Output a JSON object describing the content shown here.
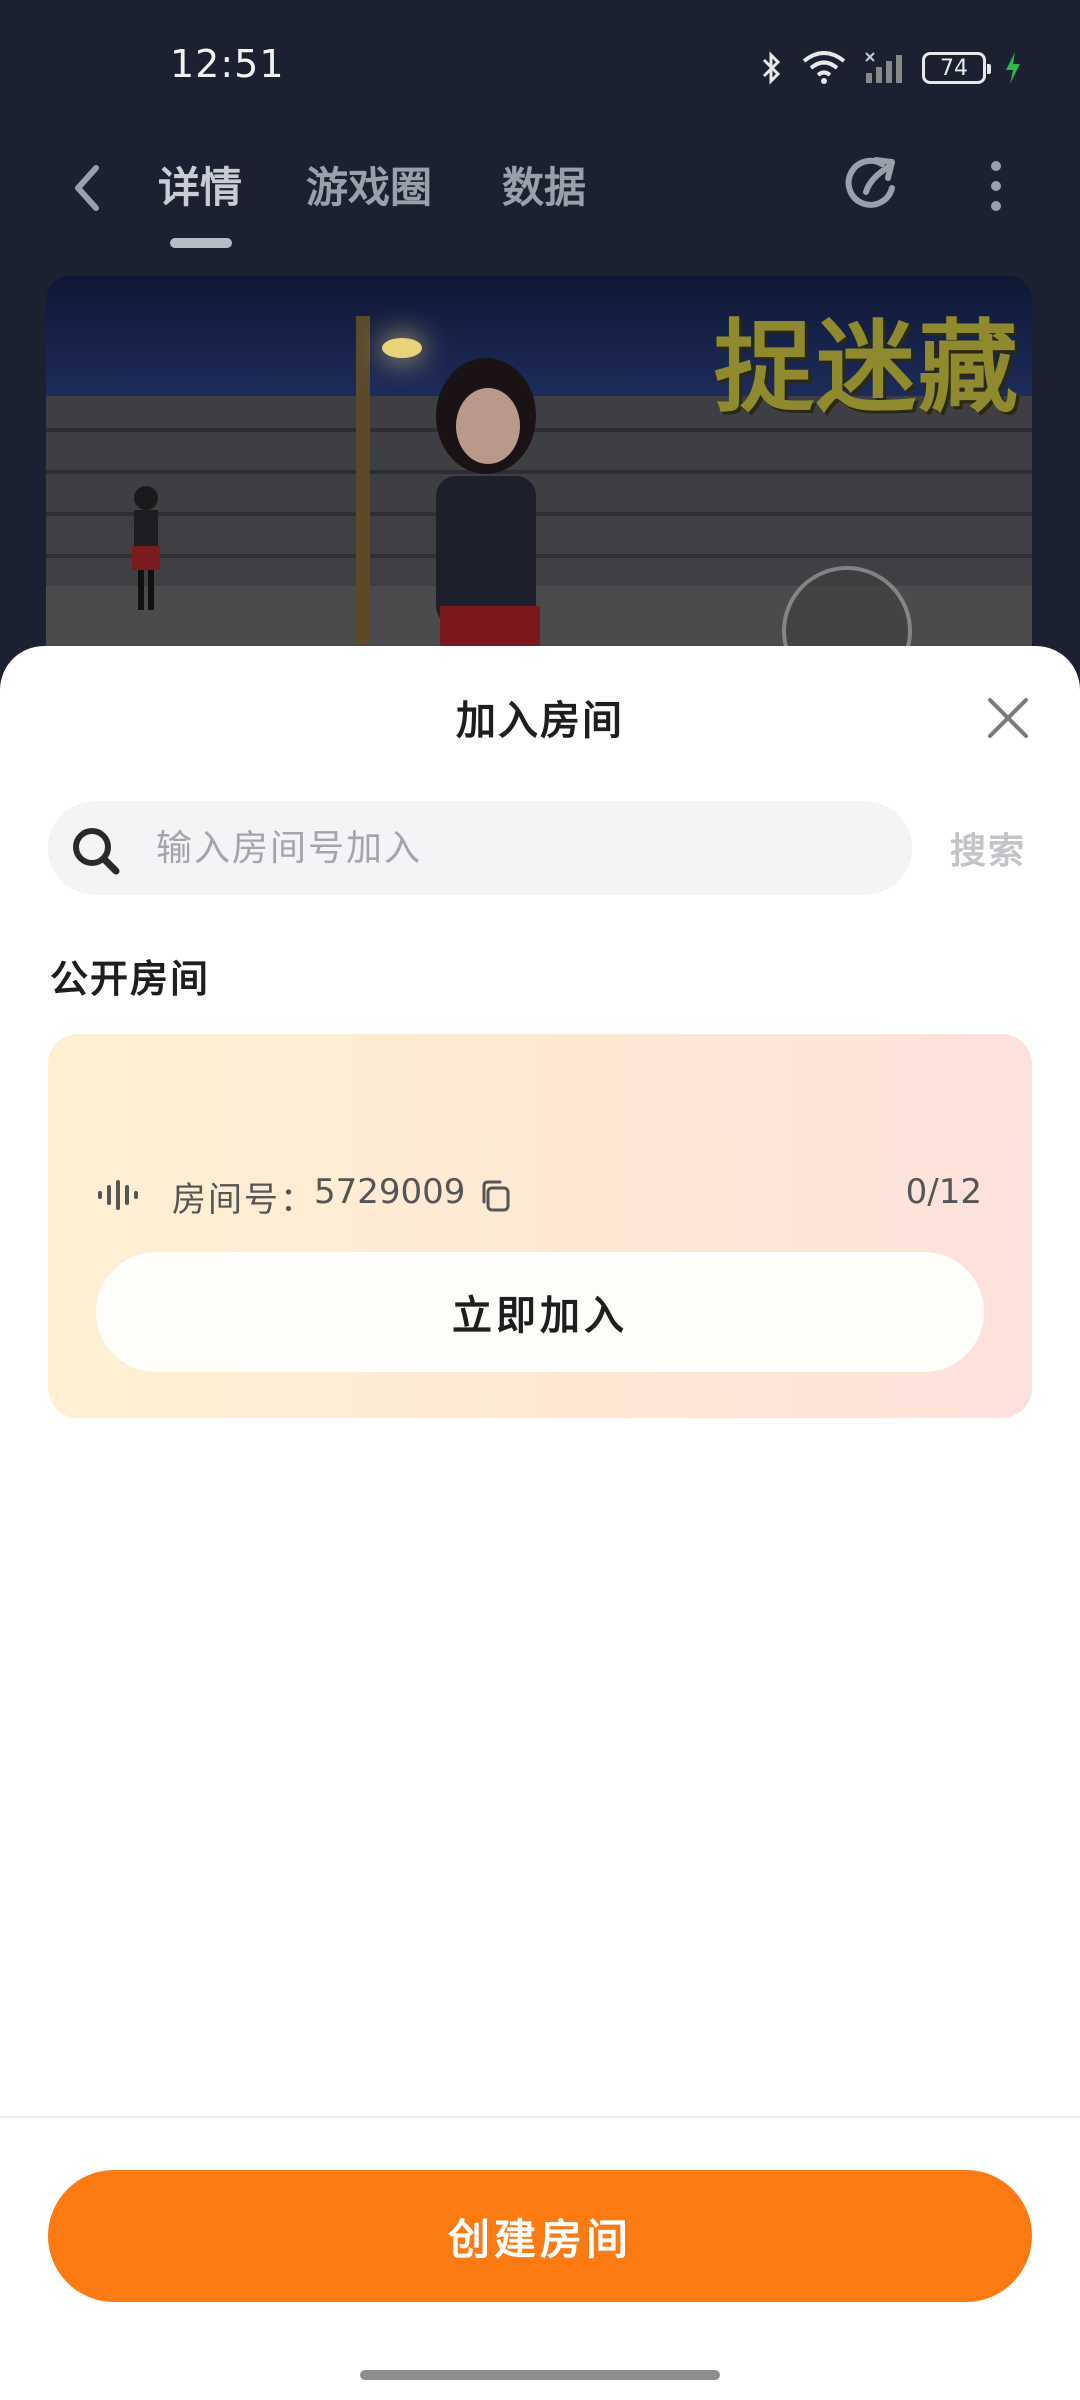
{
  "status_bar": {
    "time": "12:51",
    "battery": "74"
  },
  "nav": {
    "tabs": [
      {
        "label": "详情"
      },
      {
        "label": "游戏圈"
      },
      {
        "label": "数据"
      }
    ]
  },
  "banner": {
    "title": "捉迷藏"
  },
  "sheet": {
    "title": "加入房间",
    "search": {
      "placeholder": "输入房间号加入",
      "button_label": "搜索"
    },
    "section_title": "公开房间",
    "room": {
      "label": "房间号：",
      "number": "5729009",
      "count": "0/12",
      "join_label": "立即加入"
    },
    "create_label": "创建房间"
  },
  "colors": {
    "accent": "#fc7a12",
    "card_gradient_start": "#fff0d4",
    "card_gradient_end": "#fde1dc"
  }
}
